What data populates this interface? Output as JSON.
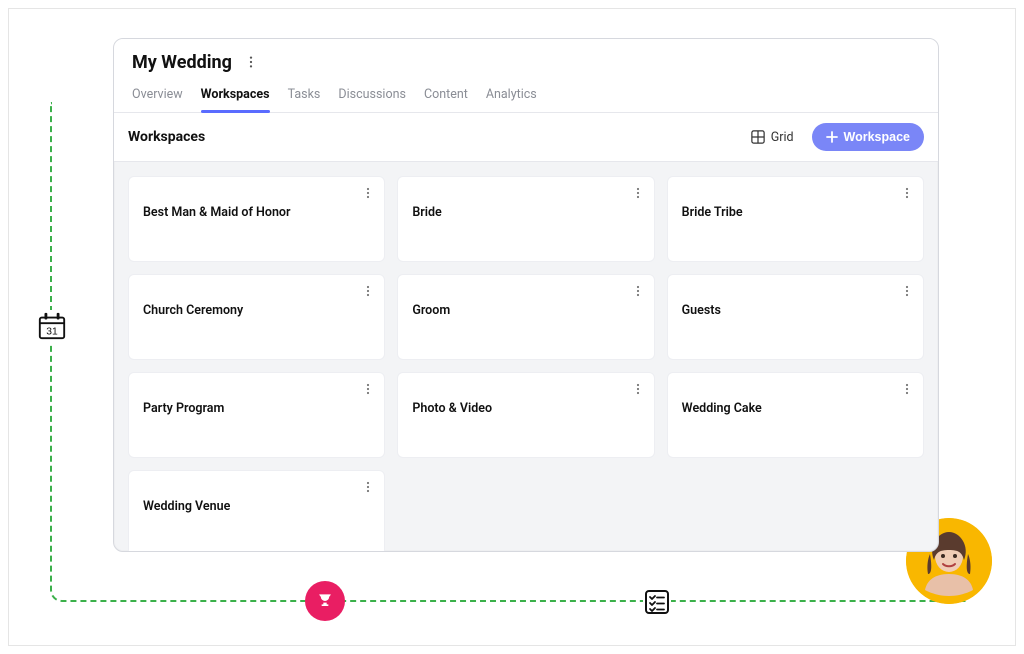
{
  "header": {
    "title": "My Wedding"
  },
  "tabs": [
    {
      "label": "Overview",
      "active": false
    },
    {
      "label": "Workspaces",
      "active": true
    },
    {
      "label": "Tasks",
      "active": false
    },
    {
      "label": "Discussions",
      "active": false
    },
    {
      "label": "Content",
      "active": false
    },
    {
      "label": "Analytics",
      "active": false
    }
  ],
  "section": {
    "title": "Workspaces",
    "view_label": "Grid",
    "add_button_label": "Workspace"
  },
  "workspaces": [
    {
      "title": "Best Man & Maid of Honor"
    },
    {
      "title": "Bride"
    },
    {
      "title": "Bride Tribe"
    },
    {
      "title": "Church Ceremony"
    },
    {
      "title": "Groom"
    },
    {
      "title": "Guests"
    },
    {
      "title": "Party Program"
    },
    {
      "title": "Photo & Video"
    },
    {
      "title": "Wedding Cake"
    },
    {
      "title": "Wedding Venue"
    }
  ],
  "decor": {
    "calendar_day": "31"
  }
}
